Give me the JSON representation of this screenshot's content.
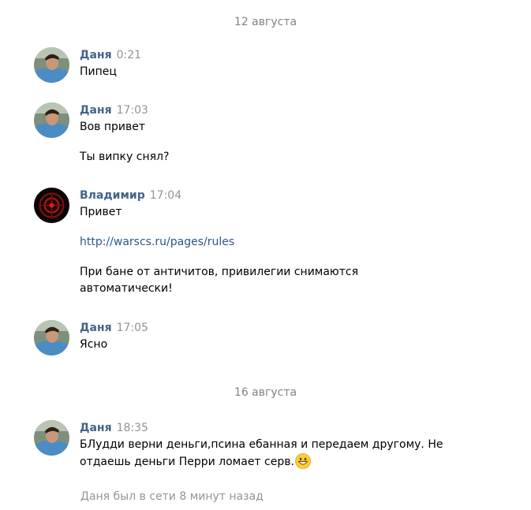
{
  "dates": [
    "12 августа",
    "16 августа"
  ],
  "messages": [
    {
      "author": "Даня",
      "time": "0:21",
      "lines": [
        "Пипец"
      ],
      "avatar": "boy-photo-avatar"
    },
    {
      "author": "Даня",
      "time": "17:03",
      "lines": [
        "Вов привет",
        "Ты випку снял?"
      ],
      "avatar": "boy-photo-avatar"
    },
    {
      "author": "Владимир",
      "time": "17:04",
      "lines": [
        "Привет",
        "http://warscs.ru/pages/rules",
        "При бане от античитов, привилегии снимаются автоматически!"
      ],
      "avatar": "dark-red-logo-avatar"
    },
    {
      "author": "Даня",
      "time": "17:05",
      "lines": [
        "Ясно"
      ],
      "avatar": "boy-photo-avatar"
    },
    {
      "author": "Даня",
      "time": "18:35",
      "lines": [
        "БЛудди верни деньги,псина ебанная и передаем другому. Не отдаешь деньги Перри ломает серв."
      ],
      "emoji": "grinning-face-emoji",
      "avatar": "boy-photo-avatar"
    }
  ],
  "status": "Даня был в сети 8 минут назад",
  "colors": {
    "author": "#42648b",
    "link": "#2a5885",
    "meta": "#939393"
  }
}
